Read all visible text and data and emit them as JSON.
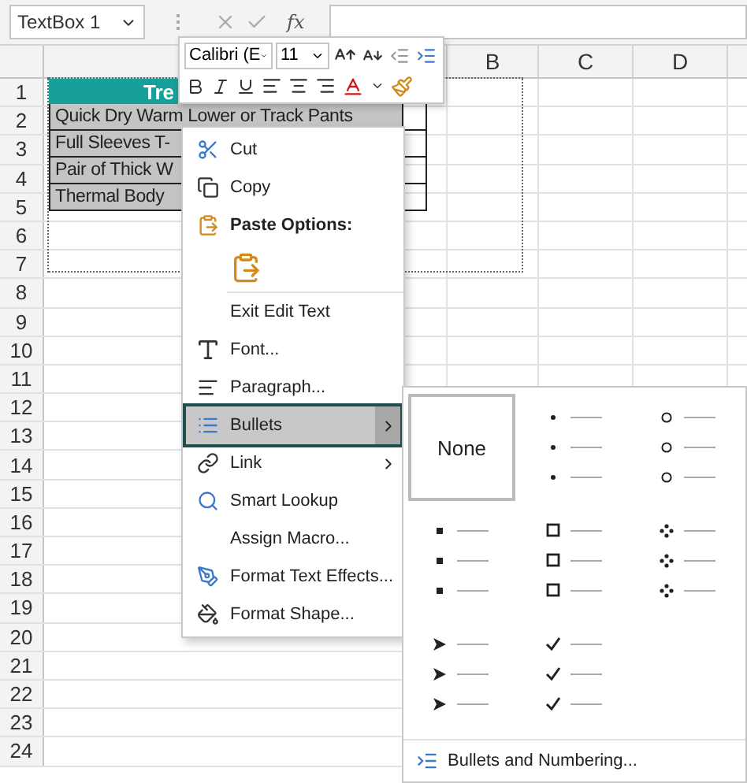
{
  "name_box": {
    "value": "TextBox 1"
  },
  "formula_bar": {
    "function_label": "fx"
  },
  "column_headers": [
    "B",
    "C",
    "D"
  ],
  "row_headers": [
    "1",
    "2",
    "3",
    "4",
    "5",
    "6",
    "7",
    "8",
    "9",
    "10",
    "11",
    "12",
    "13",
    "14",
    "15",
    "16",
    "17",
    "18",
    "19",
    "20",
    "21",
    "22",
    "23",
    "24"
  ],
  "text_box": {
    "header": "Tre",
    "rows": [
      "Quick Dry Warm Lower or Track Pants",
      "Full Sleeves T-",
      "Pair of Thick W",
      "Thermal Body"
    ]
  },
  "mini_toolbar": {
    "font": "Calibri (E",
    "size": "11"
  },
  "context_menu": {
    "items": [
      {
        "kind": "command",
        "label": "Cut",
        "selected": false
      },
      {
        "kind": "command",
        "label": "Copy",
        "selected": false
      },
      {
        "kind": "header",
        "label": "Paste Options:"
      },
      {
        "kind": "paste"
      },
      {
        "kind": "command",
        "label": "Exit Edit Text",
        "selected": false
      },
      {
        "kind": "command",
        "label": "Font...",
        "selected": false
      },
      {
        "kind": "command",
        "label": "Paragraph...",
        "selected": false
      },
      {
        "kind": "submenu",
        "label": "Bullets",
        "selected": true
      },
      {
        "kind": "submenu",
        "label": "Link",
        "selected": false
      },
      {
        "kind": "command",
        "label": "Smart Lookup",
        "selected": false
      },
      {
        "kind": "command",
        "label": "Assign Macro...",
        "selected": false
      },
      {
        "kind": "command",
        "label": "Format Text Effects...",
        "selected": false
      },
      {
        "kind": "command",
        "label": "Format Shape...",
        "selected": false
      }
    ]
  },
  "bullets_submenu": {
    "styles": [
      {
        "kind": "none",
        "label": "None",
        "selected": true
      },
      {
        "kind": "dot",
        "selected": false
      },
      {
        "kind": "circle",
        "selected": false
      },
      {
        "kind": "square",
        "selected": false
      },
      {
        "kind": "hollow-square",
        "selected": false
      },
      {
        "kind": "diamond",
        "selected": false
      },
      {
        "kind": "arrow",
        "selected": false
      },
      {
        "kind": "check",
        "selected": false
      }
    ],
    "footer": "Bullets and Numbering..."
  }
}
